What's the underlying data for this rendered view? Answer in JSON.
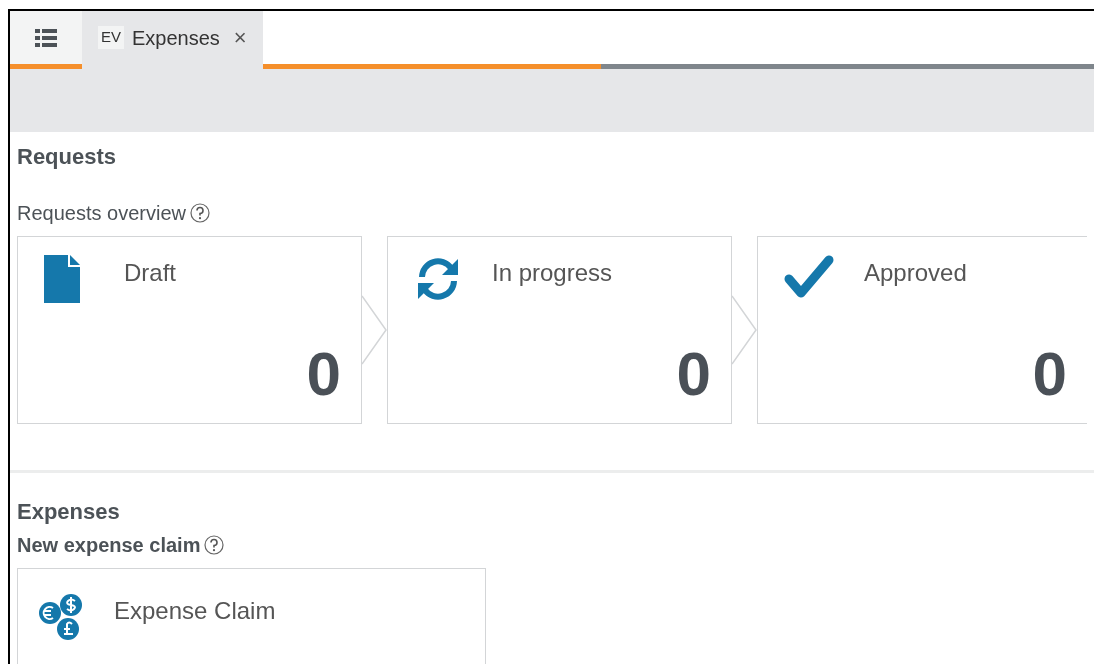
{
  "tabs": [
    {
      "kind": "menu",
      "selected": false
    },
    {
      "kind": "page",
      "badge": "EV",
      "label": "Expenses",
      "close": "×",
      "selected": true
    }
  ],
  "progress": {
    "level": 0.545
  },
  "sections": [
    {
      "title": "Requests",
      "subtitle": "Requests overview",
      "subtitle_bold": false,
      "cards": [
        {
          "kind": "draft",
          "label": "Draft",
          "count": "0"
        },
        {
          "kind": "progress",
          "label": "In progress",
          "count": "0"
        },
        {
          "kind": "approved",
          "label": "Approved",
          "count": "0"
        }
      ]
    },
    {
      "title": "Expenses",
      "subtitle": "New expense claim",
      "subtitle_bold": true,
      "cards": [
        {
          "kind": "claim",
          "label": "Expense Claim"
        }
      ]
    }
  ]
}
